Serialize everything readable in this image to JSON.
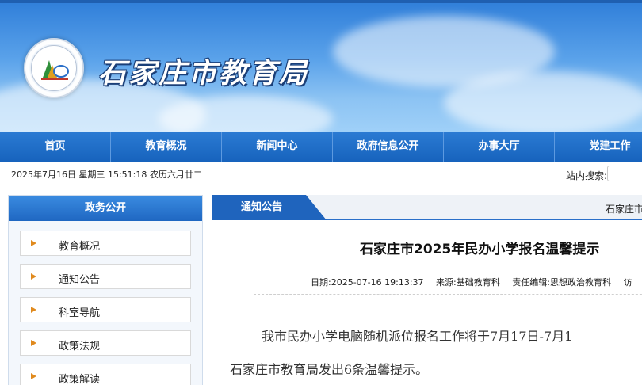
{
  "header": {
    "site_title": "石家庄市教育局"
  },
  "nav": {
    "items": [
      "首页",
      "教育概况",
      "新闻中心",
      "政府信息公开",
      "办事大厅",
      "党建工作"
    ]
  },
  "infobar": {
    "datetime": "2025年7月16日 星期三 15:51:18 农历六月廿二",
    "search_label": "站内搜索:",
    "search_value": ""
  },
  "sidebar": {
    "title": "政务公开",
    "items": [
      "教育概况",
      "通知公告",
      "科室导航",
      "政策法规",
      "政策解读"
    ]
  },
  "main": {
    "tab_label": "通知公告",
    "breadcrumb_partial": "石家庄市",
    "article": {
      "title": "石家庄市2025年民办小学报名温馨提示",
      "date": "日期:2025-07-16 19:13:37",
      "source": "来源:基础教育科",
      "editor": "责任编辑:思想政治教育科",
      "visits_partial": "访",
      "paragraph_1": "我市民办小学电脑随机派位报名工作将于7月17日-7月1",
      "paragraph_2": "石家庄市教育局发出6条温馨提示。"
    }
  },
  "colors": {
    "nav_blue": "#1763bd",
    "accent_orange": "#e08a1e"
  }
}
